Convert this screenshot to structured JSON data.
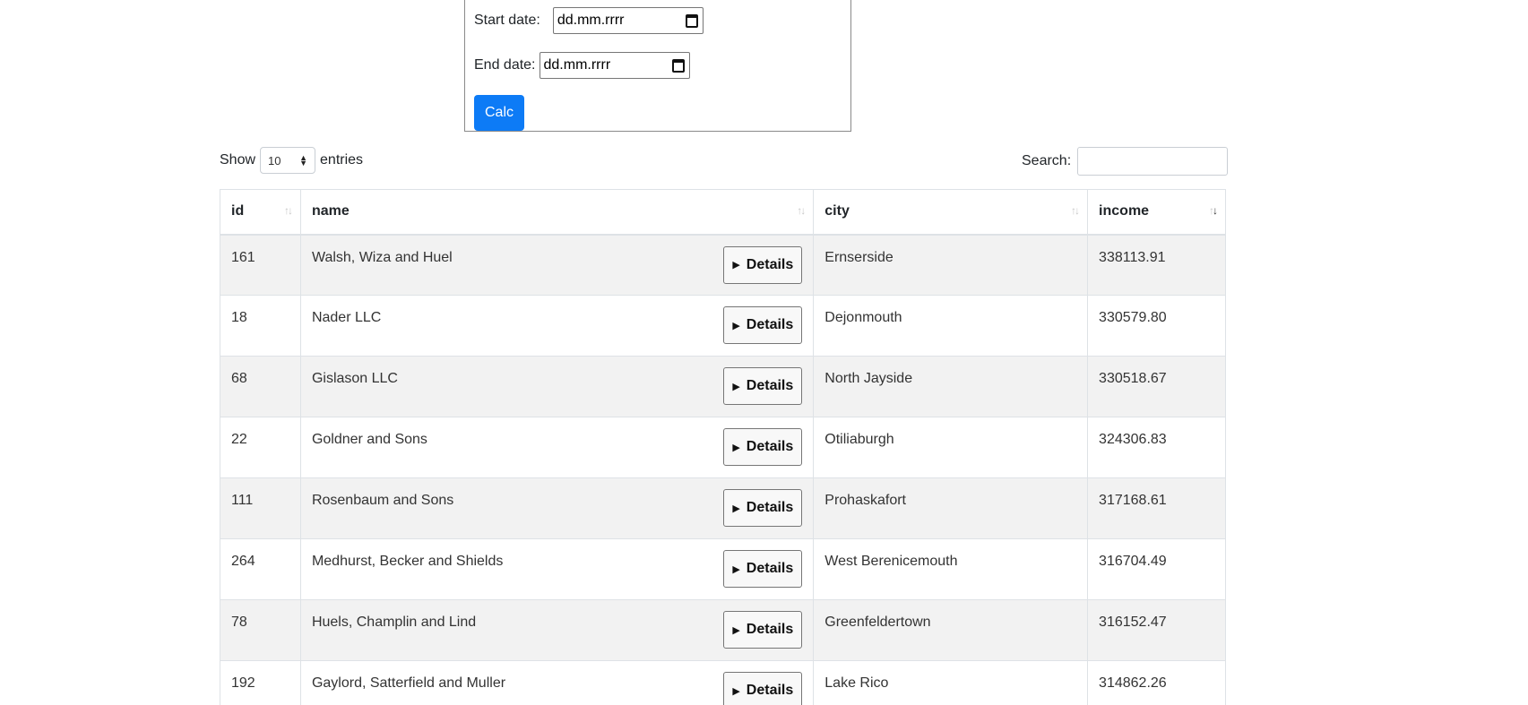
{
  "date_form": {
    "start_label": "Start date:",
    "start_value": "dd.mm.rrrr",
    "end_label": "End date:",
    "end_value": "dd.mm.rrrr",
    "calc_label": "Calc"
  },
  "length": {
    "prefix": "Show",
    "value": "10",
    "suffix": "entries"
  },
  "search": {
    "label": "Search:"
  },
  "table": {
    "columns": [
      "id",
      "name",
      "city",
      "income"
    ],
    "details_label": "Details",
    "rows": [
      {
        "id": "161",
        "name": "Walsh, Wiza and Huel",
        "city": "Ernserside",
        "income": "338113.91"
      },
      {
        "id": "18",
        "name": "Nader LLC",
        "city": "Dejonmouth",
        "income": "330579.80"
      },
      {
        "id": "68",
        "name": "Gislason LLC",
        "city": "North Jayside",
        "income": "330518.67"
      },
      {
        "id": "22",
        "name": "Goldner and Sons",
        "city": "Otiliaburgh",
        "income": "324306.83"
      },
      {
        "id": "111",
        "name": "Rosenbaum and Sons",
        "city": "Prohaskafort",
        "income": "317168.61"
      },
      {
        "id": "264",
        "name": "Medhurst, Becker and Shields",
        "city": "West Berenicemouth",
        "income": "316704.49"
      },
      {
        "id": "78",
        "name": "Huels, Champlin and Lind",
        "city": "Greenfeldertown",
        "income": "316152.47"
      },
      {
        "id": "192",
        "name": "Gaylord, Satterfield and Muller",
        "city": "Lake Rico",
        "income": "314862.26"
      }
    ]
  }
}
